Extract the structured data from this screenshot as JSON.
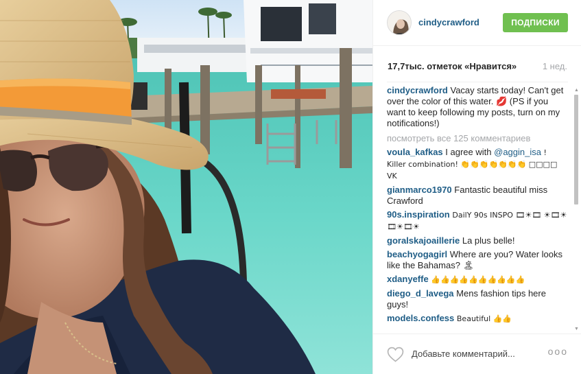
{
  "post": {
    "author": "cindycrawford",
    "follow_label": "ПОДПИСКИ",
    "likes": "17,7тыс. отметок «Нравится»",
    "time_ago": "1 нед.",
    "caption_user": "cindycrawford",
    "caption_text": "Vacay starts today! Can't get over the color of this water. 💋 (PS if you want to keep following my posts, turn on my notifications!)",
    "view_all_comments": "посмотреть все 125 комментариев",
    "add_comment_placeholder": "Добавьте комментарий...",
    "more_label": "ooo"
  },
  "comments": [
    {
      "user": "voula_kafkas",
      "pre": "I agree with ",
      "mention": "@aggin_isa",
      "post": " ! Killer combination! 👏👏👏👏👏👏👏 □□□□ VK"
    },
    {
      "user": "gianmarco1970",
      "text": "Fantastic beautiful miss Crawford"
    },
    {
      "user": "90s.inspiration",
      "text": "DailY 90s INSPO 🎞☀🎞 ☀🎞☀🎞☀🎞☀"
    },
    {
      "user": "goralskajoaillerie",
      "text": "La plus belle!"
    },
    {
      "user": "beachyogagirl",
      "text": "Where are you? Water looks like the Bahamas? 🏝"
    },
    {
      "user": "xdanyeffe",
      "text": "👍👍👍👍👍👍👍👍👍👍"
    },
    {
      "user": "diego_d_lavega",
      "text": "Mens fashion tips here guys!"
    },
    {
      "user": "models.confess",
      "text": "Beautiful 👍👍"
    }
  ],
  "icons": {
    "heart": "heart-icon",
    "more": "more-options-icon",
    "scroll_up": "scroll-up-arrow",
    "scroll_down": "scroll-down-arrow"
  },
  "colors": {
    "username_link": "#1f5d86",
    "follow_button": "#70c050",
    "muted_text": "#a5a7aa",
    "water": "#5fd0c4"
  }
}
